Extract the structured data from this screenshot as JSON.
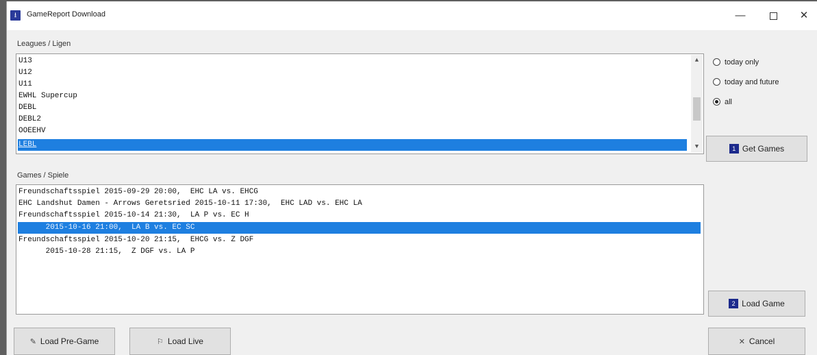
{
  "window": {
    "title": "GameReport Download",
    "icon": "download-icon",
    "controls": {
      "minimize": "—",
      "close": "✕"
    }
  },
  "leagues": {
    "label": "Leagues / Ligen",
    "items": [
      "U13",
      "U12",
      "U11",
      "EWHL Supercup",
      "DEBL",
      "DEBL2",
      "OOEEHV",
      "LEBL"
    ],
    "selected_index": 7
  },
  "filter": {
    "options": [
      "today only",
      "today and future",
      "all"
    ],
    "selected": "all"
  },
  "games": {
    "label": "Games / Spiele",
    "items": [
      "Freundschaftsspiel 2015-09-29 20:00,  EHC LA vs. EHCG",
      "EHC Landshut Damen - Arrows Geretsried 2015-10-11 17:30,  EHC LAD vs. EHC LA",
      "Freundschaftsspiel 2015-10-14 21:30,  LA P vs. EC H",
      "      2015-10-16 21:00,  LA B vs. EC SC",
      "Freundschaftsspiel 2015-10-20 21:15,  EHCG vs. Z DGF",
      "      2015-10-28 21:15,  Z DGF vs. LA P"
    ],
    "selected_index": 3
  },
  "buttons": {
    "get_games": {
      "num": "1",
      "label": "Get Games"
    },
    "load_game": {
      "num": "2",
      "label": "Load Game"
    },
    "load_pregame": {
      "icon": "edit-icon",
      "label": "Load Pre-Game"
    },
    "load_live": {
      "icon": "live-icon",
      "label": "Load Live"
    },
    "cancel": {
      "icon": "close-icon",
      "label": "Cancel"
    }
  },
  "colors": {
    "selection": "#1e7fe0",
    "number_badge": "#1c2a8c"
  }
}
